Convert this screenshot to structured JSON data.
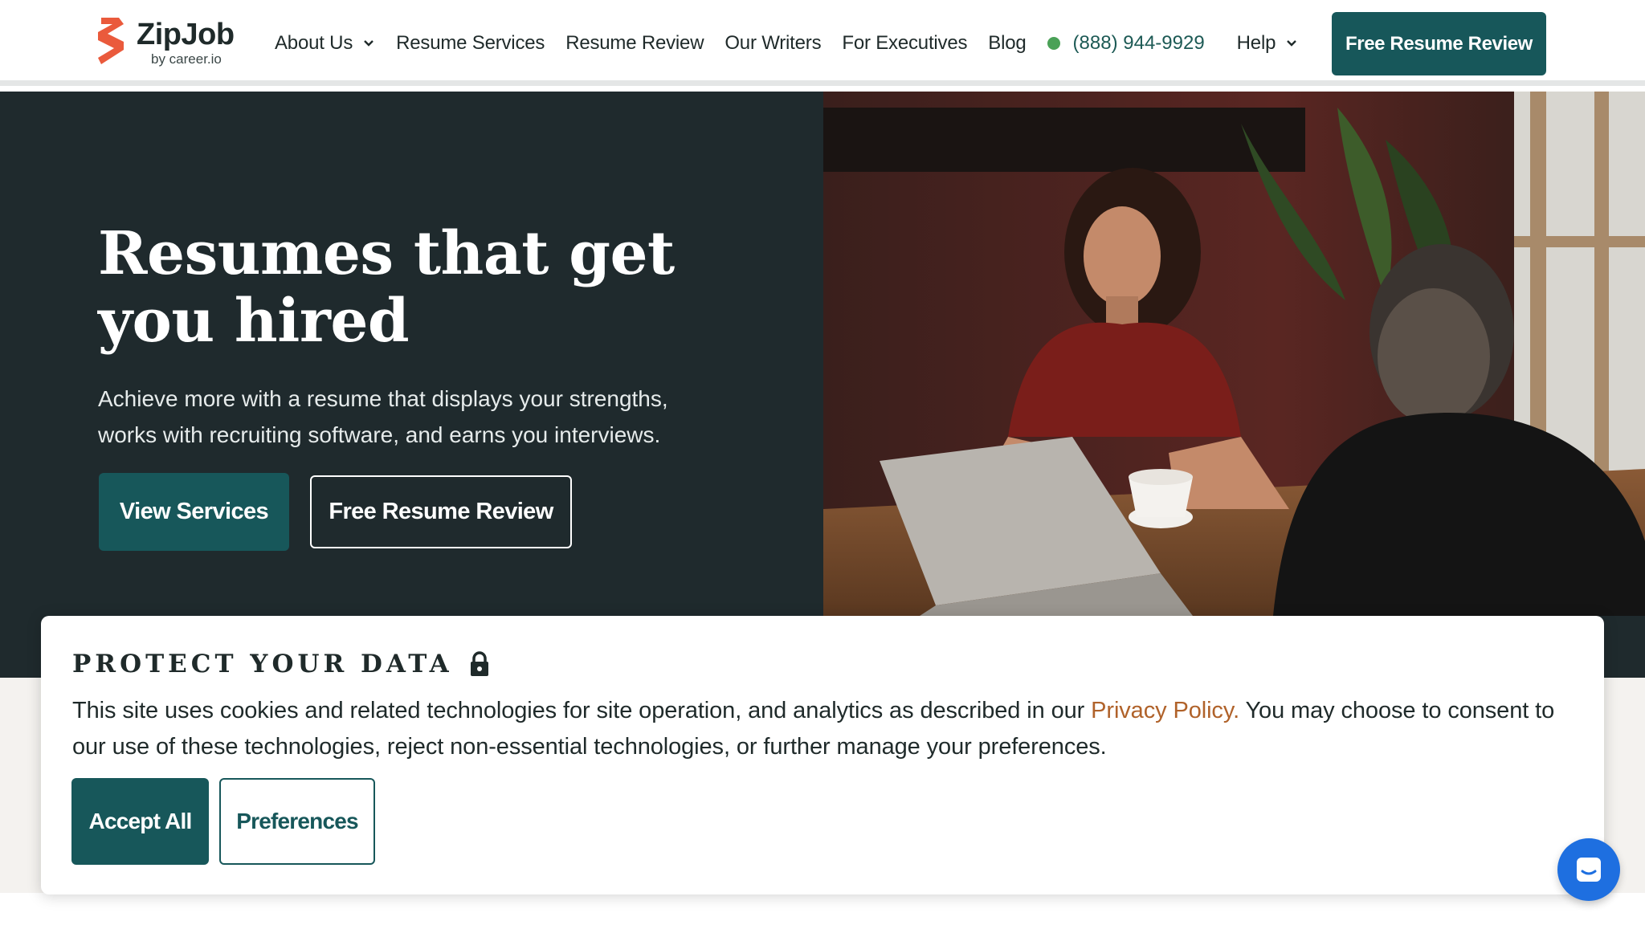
{
  "brand": {
    "name": "ZipJob",
    "sub": "by career.io"
  },
  "nav": {
    "items": [
      {
        "label": "About Us",
        "has_dropdown": true
      },
      {
        "label": "Resume Services",
        "has_dropdown": false
      },
      {
        "label": "Resume Review",
        "has_dropdown": false
      },
      {
        "label": "Our Writers",
        "has_dropdown": false
      },
      {
        "label": "For Executives",
        "has_dropdown": false
      },
      {
        "label": "Blog",
        "has_dropdown": false
      }
    ],
    "phone": "(888) 944-9929",
    "help": "Help",
    "cta": "Free Resume Review"
  },
  "hero": {
    "title": "Resumes that get you hired",
    "subtitle": "Achieve more with a resume that displays your strengths, works with recruiting software, and earns you interviews.",
    "primary_button": "View Services",
    "secondary_button": "Free Resume Review"
  },
  "cookie": {
    "title": "PROTECT YOUR DATA",
    "text_before": "This site uses cookies and related technologies for site operation, and analytics as described in our ",
    "link": "Privacy Policy.",
    "text_after": " You may choose to consent to our use of these technologies, reject non-essential technologies, or further manage your preferences.",
    "accept": "Accept All",
    "preferences": "Preferences"
  },
  "colors": {
    "brand_teal": "#17575a",
    "hero_bg": "#1f2a2d",
    "link_orange": "#b0622a",
    "status_green": "#4aa157",
    "chat_blue": "#1e6fe0"
  },
  "icons": [
    "zipjob-logo-icon",
    "chevron-down-icon",
    "status-dot-icon",
    "lock-icon",
    "chat-icon"
  ]
}
